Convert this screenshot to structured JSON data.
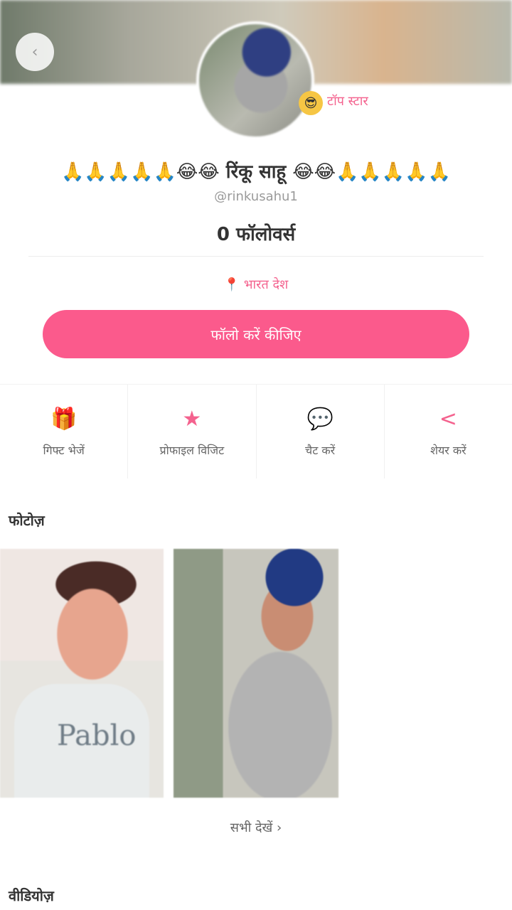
{
  "colors": {
    "accent": "#fb5a8c",
    "accent_text": "#f4628e",
    "cover": "#b7b9ad"
  },
  "header": {
    "back_icon": "‹",
    "badge_emoji": "😎",
    "badge_label": "टॉप स्टार"
  },
  "profile": {
    "name": "🙏🙏🙏🙏🙏😂😂 रिंकू साहू 😂😂🙏🙏🙏🙏🙏",
    "handle": "@rinkusahu1",
    "followers": "0 फॉलोवर्स",
    "location_icon": "📍",
    "location": "भारत देश"
  },
  "follow_button": {
    "label": "फॉलो करें कीजिए"
  },
  "actions": [
    {
      "icon": "gift-icon",
      "glyph": "🎁",
      "label": "गिफ्ट भेजें"
    },
    {
      "icon": "star-icon",
      "glyph": "★",
      "label": "प्रोफाइल विजिट"
    },
    {
      "icon": "chat-icon",
      "glyph": "💬",
      "label": "चैट करें"
    },
    {
      "icon": "share-icon",
      "glyph": "<",
      "label": "शेयर करें"
    }
  ],
  "sections": {
    "photos_title": "फोटोज़",
    "photo_shirt_text": "Pablo",
    "see_more": "सभी देखें ›",
    "bottom_title": "वीडियोज़"
  }
}
